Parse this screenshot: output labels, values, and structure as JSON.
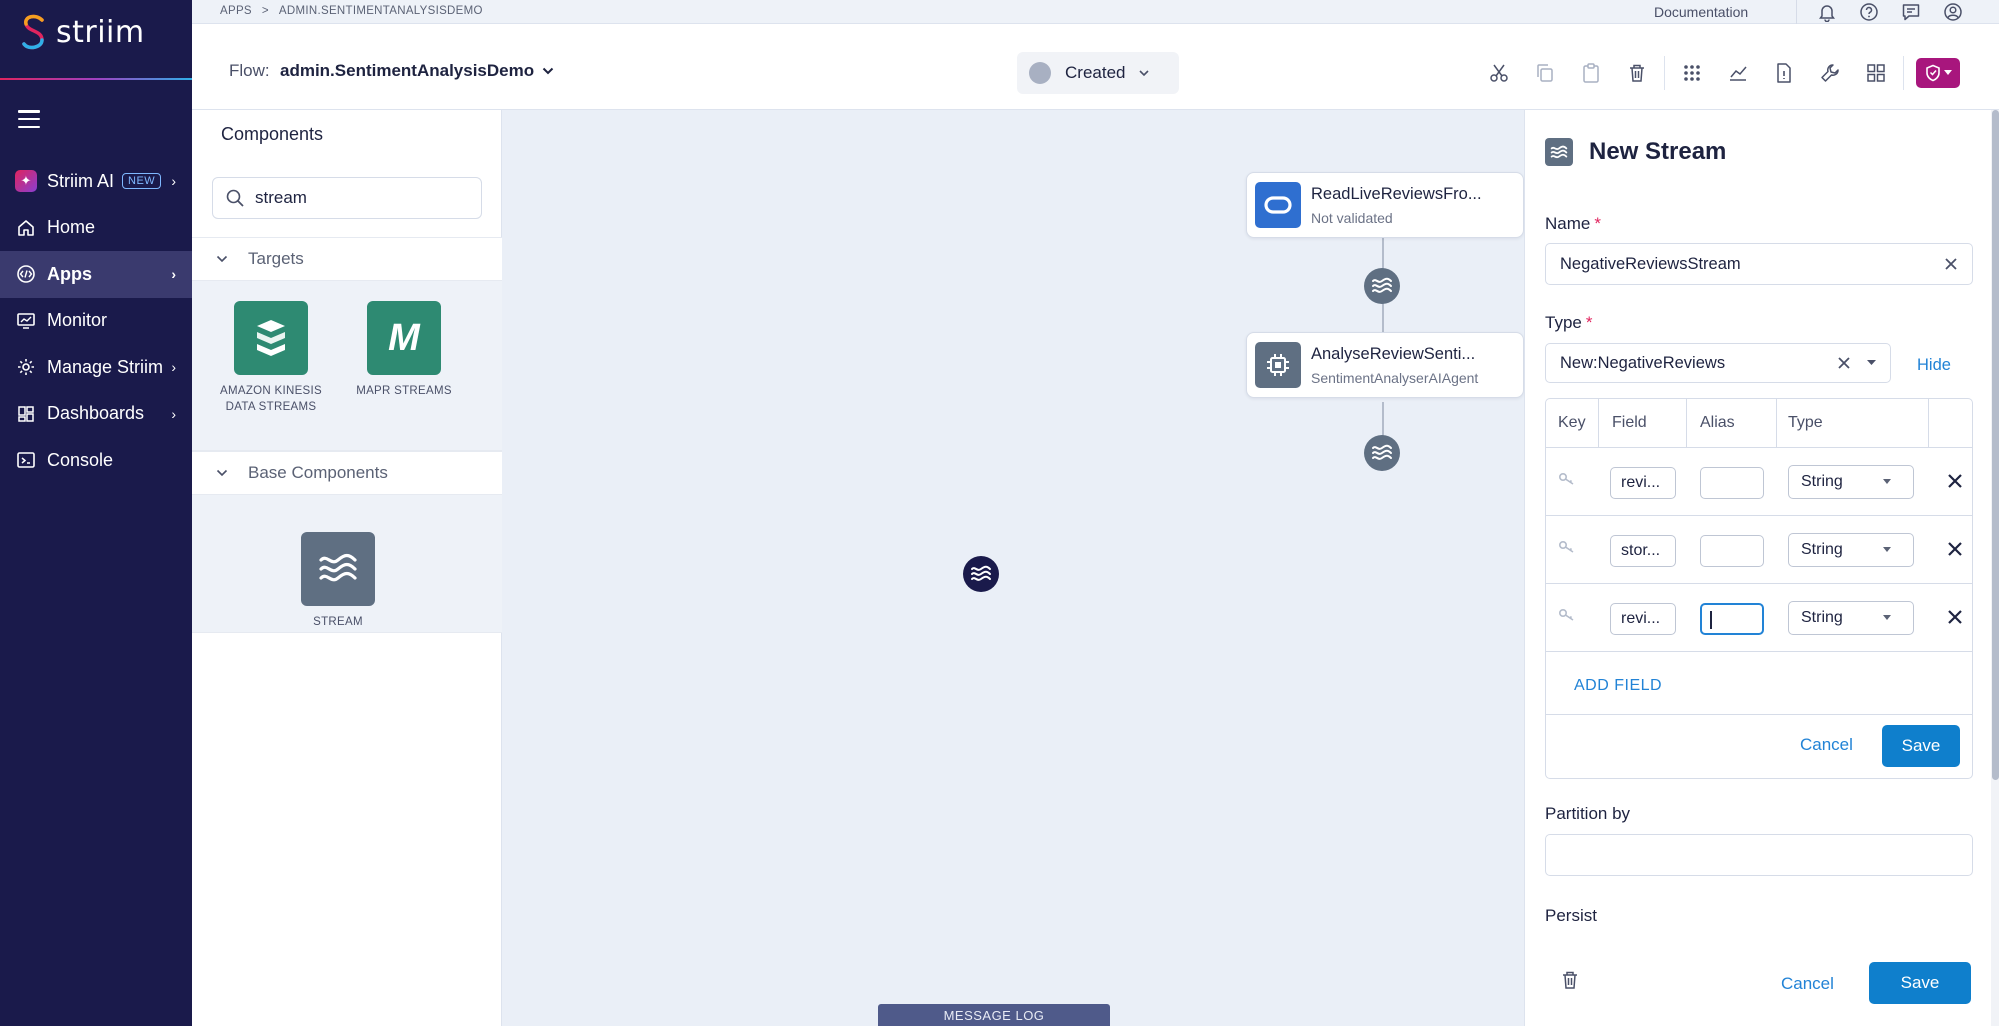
{
  "brand": {
    "name": "striim"
  },
  "sidebar": {
    "items": [
      {
        "label": "Striim AI",
        "badge": "NEW",
        "icon": "sparkle-icon",
        "has_chevron": true
      },
      {
        "label": "Home",
        "icon": "home-icon",
        "has_chevron": false
      },
      {
        "label": "Apps",
        "icon": "apps-icon",
        "has_chevron": true,
        "active": true
      },
      {
        "label": "Monitor",
        "icon": "monitor-icon",
        "has_chevron": false
      },
      {
        "label": "Manage Striim",
        "icon": "gear-icon",
        "has_chevron": true
      },
      {
        "label": "Dashboards",
        "icon": "dashboard-icon",
        "has_chevron": true
      },
      {
        "label": "Console",
        "icon": "console-icon",
        "has_chevron": false
      }
    ]
  },
  "topbar": {
    "breadcrumb": [
      "APPS",
      ">",
      "ADMIN.SENTIMENTANALYSISDEMO"
    ],
    "documentation": "Documentation",
    "icons": [
      "bell-icon",
      "help-icon",
      "chat-icon",
      "user-icon"
    ]
  },
  "flowbar": {
    "label": "Flow:",
    "name": "admin.SentimentAnalysisDemo",
    "status": "Created",
    "tools": [
      "cut-icon",
      "copy-icon",
      "paste-icon",
      "delete-icon",
      "grid-icon",
      "chart-icon",
      "file-icon",
      "wrench-icon",
      "layout-icon",
      "shield-icon"
    ]
  },
  "components": {
    "title": "Components",
    "search_value": "stream",
    "sections": [
      {
        "label": "Targets",
        "tiles": [
          {
            "label": "AMAZON KINESIS DATA STREAMS",
            "color": "#2e8a72"
          },
          {
            "label": "MAPR STREAMS",
            "color": "#2e8a72"
          }
        ]
      },
      {
        "label": "Base Components",
        "tiles": [
          {
            "label": "STREAM",
            "color": "#5f6f82"
          }
        ]
      }
    ]
  },
  "canvas": {
    "nodes": [
      {
        "title": "ReadLiveReviewsFro...",
        "subtitle": "Not validated",
        "icon": "oracle-icon",
        "color": "#2f6fd0"
      },
      {
        "title": "AnalyseReviewSenti...",
        "subtitle": "SentimentAnalyserAIAgent",
        "icon": "cpu-icon",
        "color": "#5f6f82"
      }
    ],
    "message_log": "MESSAGE LOG"
  },
  "stream_panel": {
    "title": "New Stream",
    "name_label": "Name",
    "name_value": "NegativeReviewsStream",
    "type_label": "Type",
    "type_value": "New:NegativeReviews",
    "hide_label": "Hide",
    "table": {
      "headers": [
        "Key",
        "Field",
        "Alias",
        "Type"
      ],
      "rows": [
        {
          "field": "revi...",
          "alias": "",
          "type": "String"
        },
        {
          "field": "stor...",
          "alias": "",
          "type": "String"
        },
        {
          "field": "revi...",
          "alias": "",
          "type": "String"
        }
      ],
      "add_field": "ADD FIELD",
      "cancel": "Cancel",
      "save": "Save"
    },
    "partition_label": "Partition by",
    "partition_value": "",
    "persist_label": "Persist",
    "footer": {
      "cancel": "Cancel",
      "save": "Save"
    }
  },
  "colors": {
    "sidebar_bg": "#1a1a4b",
    "accent": "#0f7fcc",
    "canvas_bg": "#eaeff7",
    "required": "#e0245e"
  }
}
